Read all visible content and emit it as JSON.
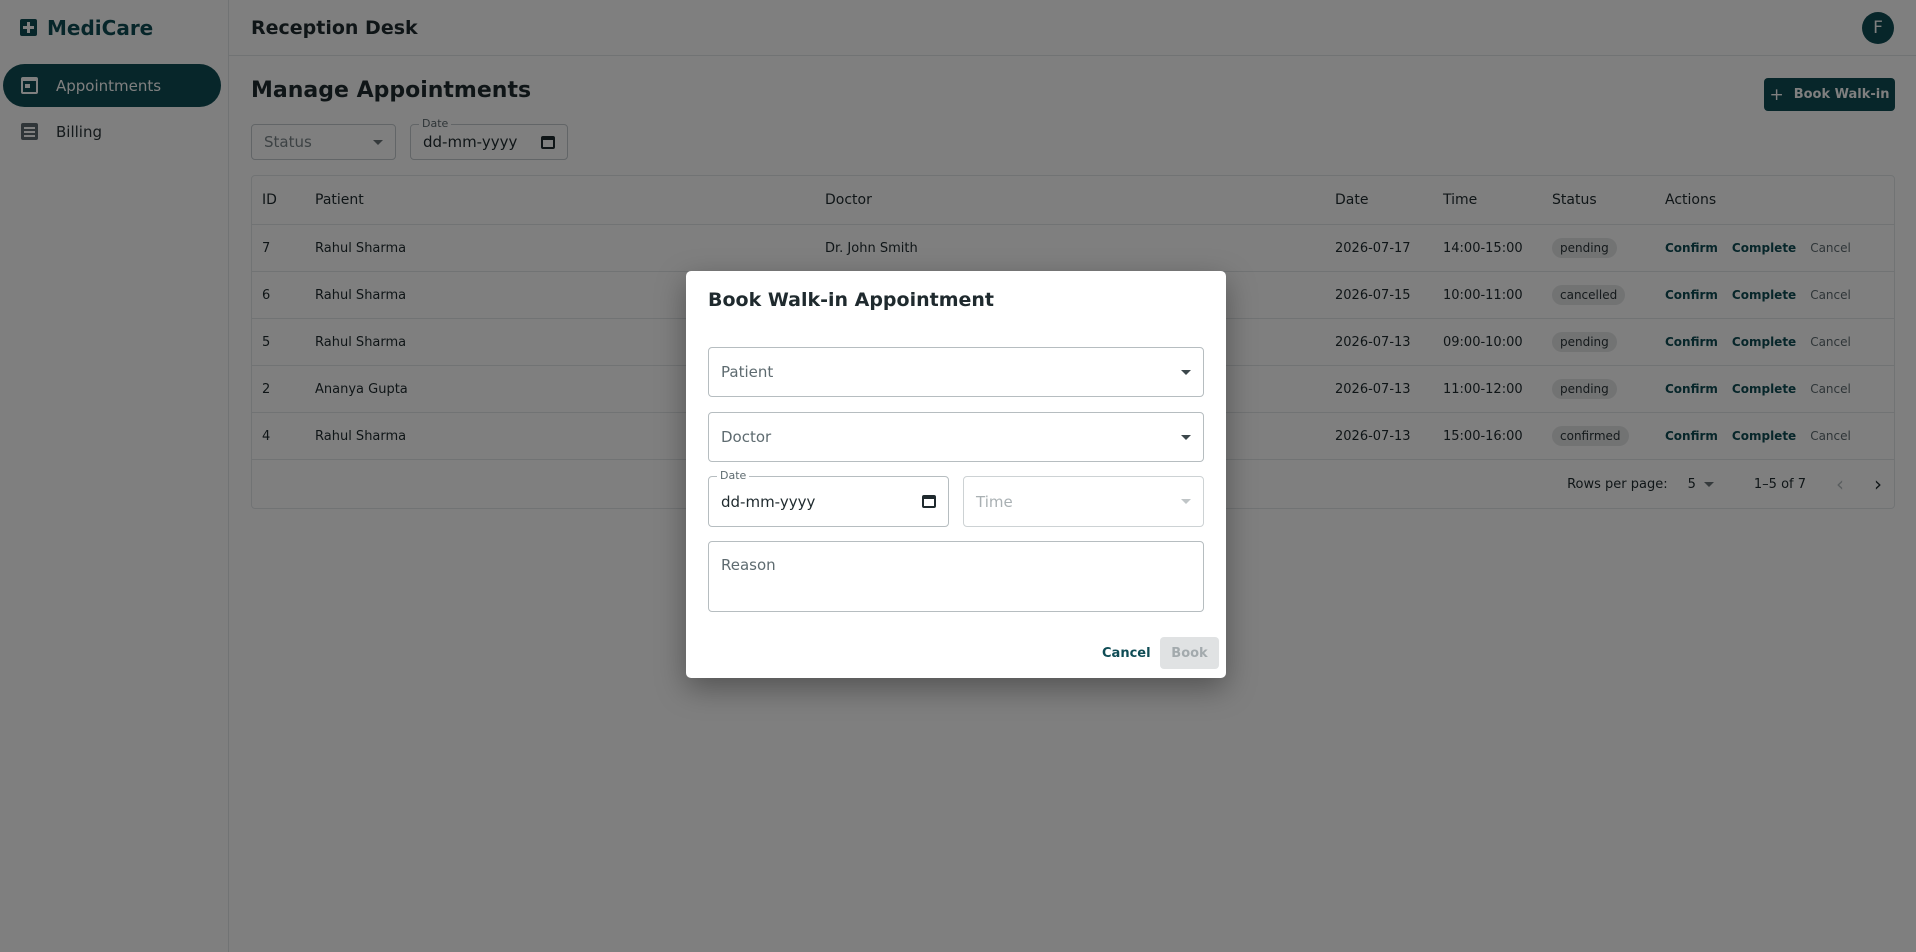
{
  "app": {
    "brand": "MediCare",
    "header_title": "Reception Desk",
    "avatar_initial": "F",
    "accent_color": "#0f4c55"
  },
  "sidebar": {
    "items": [
      {
        "label": "Appointments",
        "icon": "calendar-icon",
        "active": true
      },
      {
        "label": "Billing",
        "icon": "receipt-icon",
        "active": false
      }
    ]
  },
  "main": {
    "title": "Manage Appointments",
    "book_walkin_label": "Book Walk-in",
    "filters": {
      "status_placeholder": "Status",
      "date_label": "Date",
      "date_value": "dd-mm-yyyy"
    },
    "table": {
      "columns": [
        "ID",
        "Patient",
        "Doctor",
        "Date",
        "Time",
        "Status",
        "Actions"
      ],
      "rows": [
        {
          "id": "7",
          "patient": "Rahul Sharma",
          "doctor": "Dr. John Smith",
          "date": "2026-07-17",
          "time": "14:00-15:00",
          "status": "pending"
        },
        {
          "id": "6",
          "patient": "Rahul Sharma",
          "doctor": "",
          "date": "2026-07-15",
          "time": "10:00-11:00",
          "status": "cancelled"
        },
        {
          "id": "5",
          "patient": "Rahul Sharma",
          "doctor": "",
          "date": "2026-07-13",
          "time": "09:00-10:00",
          "status": "pending"
        },
        {
          "id": "2",
          "patient": "Ananya Gupta",
          "doctor": "",
          "date": "2026-07-13",
          "time": "11:00-12:00",
          "status": "pending"
        },
        {
          "id": "4",
          "patient": "Rahul Sharma",
          "doctor": "",
          "date": "2026-07-13",
          "time": "15:00-16:00",
          "status": "confirmed"
        }
      ],
      "actions": {
        "confirm": "Confirm",
        "complete": "Complete",
        "cancel": "Cancel"
      },
      "pagination": {
        "rows_per_page_label": "Rows per page:",
        "rows_per_page": "5",
        "range": "1–5 of 7"
      }
    }
  },
  "dialog": {
    "title": "Book Walk-in Appointment",
    "patient_placeholder": "Patient",
    "doctor_placeholder": "Doctor",
    "date_label": "Date",
    "date_value": "dd-mm-yyyy",
    "time_placeholder": "Time",
    "reason_placeholder": "Reason",
    "cancel_label": "Cancel",
    "book_label": "Book"
  }
}
